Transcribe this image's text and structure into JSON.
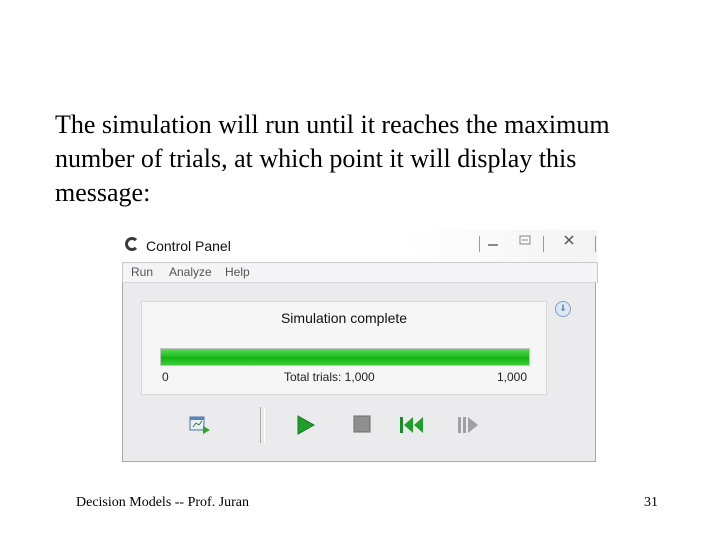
{
  "slide": {
    "body_text": "The simulation will run until it reaches the maximum number of trials, at which point it will display this message:",
    "footer_left": "Decision Models -- Prof. Juran",
    "page_number": "31"
  },
  "window": {
    "title": "Control Panel",
    "menu": [
      "Run",
      "Analyze",
      "Help"
    ],
    "status": "Simulation complete",
    "progress": {
      "fraction": 1.0,
      "min_label": "0",
      "center_label": "Total trials: 1,000",
      "max_label": "1,000",
      "color": "#22c022"
    },
    "toolbar_icons": [
      "chart-window-icon",
      "run-icon",
      "stop-icon",
      "reset-icon",
      "step-icon"
    ]
  }
}
